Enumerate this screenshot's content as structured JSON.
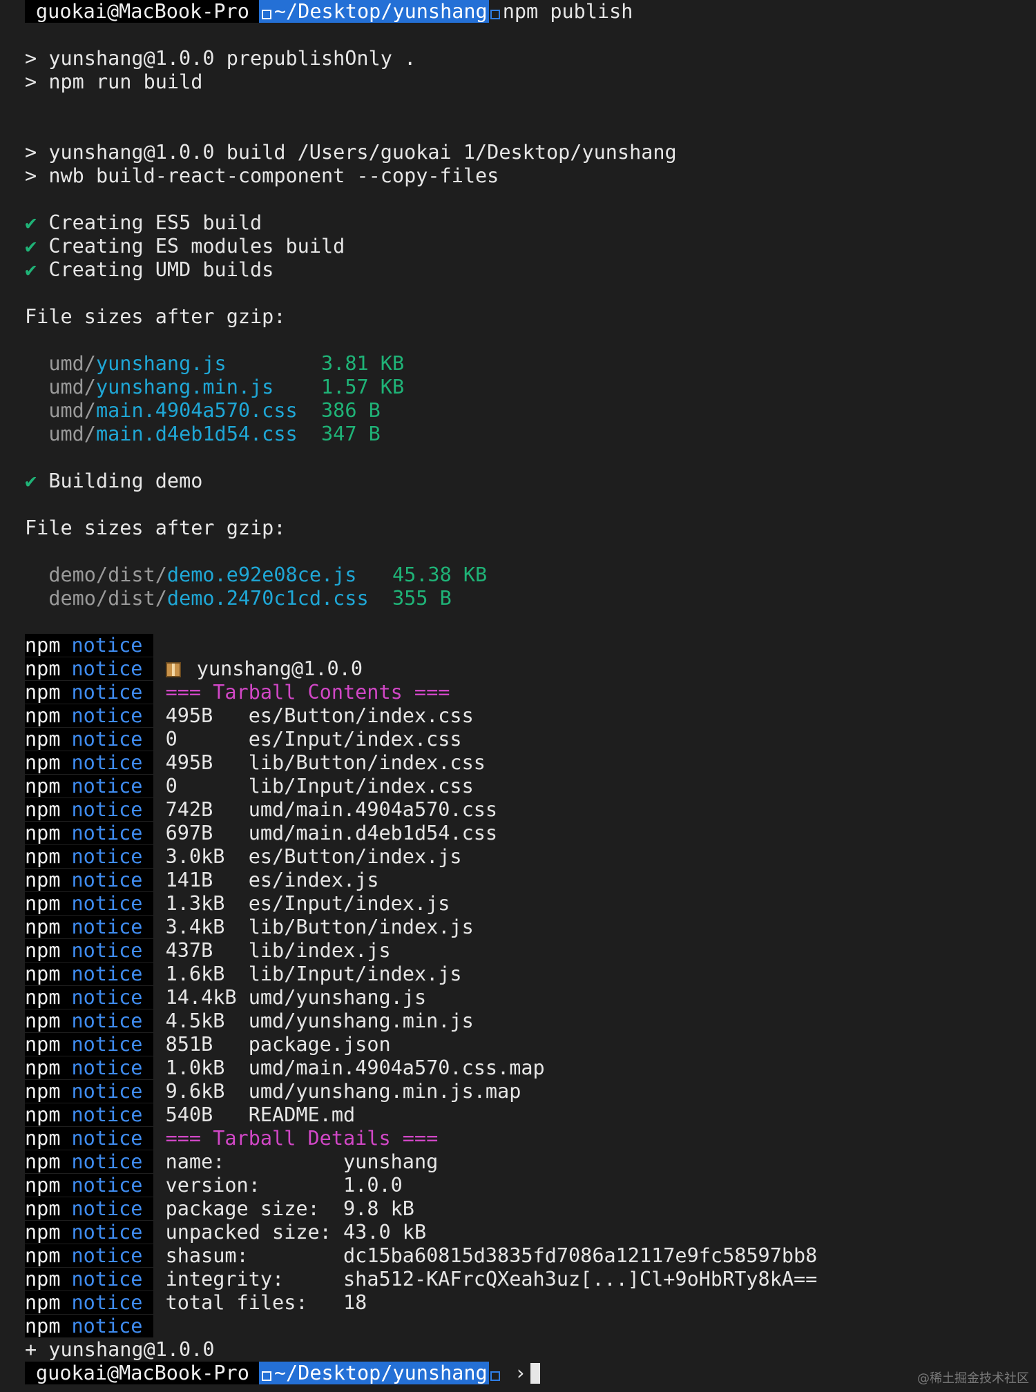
{
  "prompt": {
    "user_host": "guokai@MacBook-Pro",
    "path": "~/Desktop/yunshang",
    "command": "npm publish"
  },
  "prepublish": [
    "> yunshang@1.0.0 prepublishOnly .",
    "> npm run build"
  ],
  "build": [
    "> yunshang@1.0.0 build /Users/guokai 1/Desktop/yunshang",
    "> nwb build-react-component --copy-files"
  ],
  "check_mark": "✔",
  "steps": [
    "Creating ES5 build",
    "Creating ES modules build",
    "Creating UMD builds"
  ],
  "sizes_heading": "File sizes after gzip:",
  "umd_files": [
    {
      "dir": "umd/",
      "name": "yunshang.js",
      "pad": "        ",
      "size": "3.81 KB"
    },
    {
      "dir": "umd/",
      "name": "yunshang.min.js",
      "pad": "    ",
      "size": "1.57 KB"
    },
    {
      "dir": "umd/",
      "name": "main.4904a570.css",
      "pad": "  ",
      "size": "386 B"
    },
    {
      "dir": "umd/",
      "name": "main.d4eb1d54.css",
      "pad": "  ",
      "size": "347 B"
    }
  ],
  "demo_step": "Building demo",
  "demo_files": [
    {
      "dir": "demo/dist/",
      "name": "demo.e92e08ce.js",
      "pad": "   ",
      "size": "45.38 KB"
    },
    {
      "dir": "demo/dist/",
      "name": "demo.2470c1cd.css",
      "pad": "  ",
      "size": "355 B"
    }
  ],
  "npm_label": "npm",
  "notice_label": "notice",
  "package_line": "yunshang@1.0.0",
  "contents_heading": "=== Tarball Contents ===",
  "contents": [
    {
      "size": "495B  ",
      "file": "es/Button/index.css"
    },
    {
      "size": "0     ",
      "file": "es/Input/index.css"
    },
    {
      "size": "495B  ",
      "file": "lib/Button/index.css"
    },
    {
      "size": "0     ",
      "file": "lib/Input/index.css"
    },
    {
      "size": "742B  ",
      "file": "umd/main.4904a570.css"
    },
    {
      "size": "697B  ",
      "file": "umd/main.d4eb1d54.css"
    },
    {
      "size": "3.0kB ",
      "file": "es/Button/index.js"
    },
    {
      "size": "141B  ",
      "file": "es/index.js"
    },
    {
      "size": "1.3kB ",
      "file": "es/Input/index.js"
    },
    {
      "size": "3.4kB ",
      "file": "lib/Button/index.js"
    },
    {
      "size": "437B  ",
      "file": "lib/index.js"
    },
    {
      "size": "1.6kB ",
      "file": "lib/Input/index.js"
    },
    {
      "size": "14.4kB",
      "file": "umd/yunshang.js"
    },
    {
      "size": "4.5kB ",
      "file": "umd/yunshang.min.js"
    },
    {
      "size": "851B  ",
      "file": "package.json"
    },
    {
      "size": "1.0kB ",
      "file": "umd/main.4904a570.css.map"
    },
    {
      "size": "9.6kB ",
      "file": "umd/yunshang.min.js.map"
    },
    {
      "size": "540B  ",
      "file": "README.md"
    }
  ],
  "details_heading": "=== Tarball Details ===",
  "details": [
    {
      "key": "name:          ",
      "value": "yunshang"
    },
    {
      "key": "version:       ",
      "value": "1.0.0"
    },
    {
      "key": "package size:  ",
      "value": "9.8 kB"
    },
    {
      "key": "unpacked size: ",
      "value": "43.0 kB"
    },
    {
      "key": "shasum:        ",
      "value": "dc15ba60815d3835fd7086a12117e9fc58597bb8"
    },
    {
      "key": "integrity:     ",
      "value": "sha512-KAFrcQXeah3uz[...]Cl+9oHbRTy8kA=="
    },
    {
      "key": "total files:   ",
      "value": "18"
    }
  ],
  "published": "+ yunshang@1.0.0",
  "prompt_chevron": "›",
  "watermark": "@稀土掘金技术社区",
  "colors": {
    "background": "#1e1e1e",
    "path_segment": "#2470d6",
    "check": "#1fb377",
    "cyan": "#1fa7d6",
    "notice": "#3f8cf0",
    "magenta": "#d147c6"
  }
}
